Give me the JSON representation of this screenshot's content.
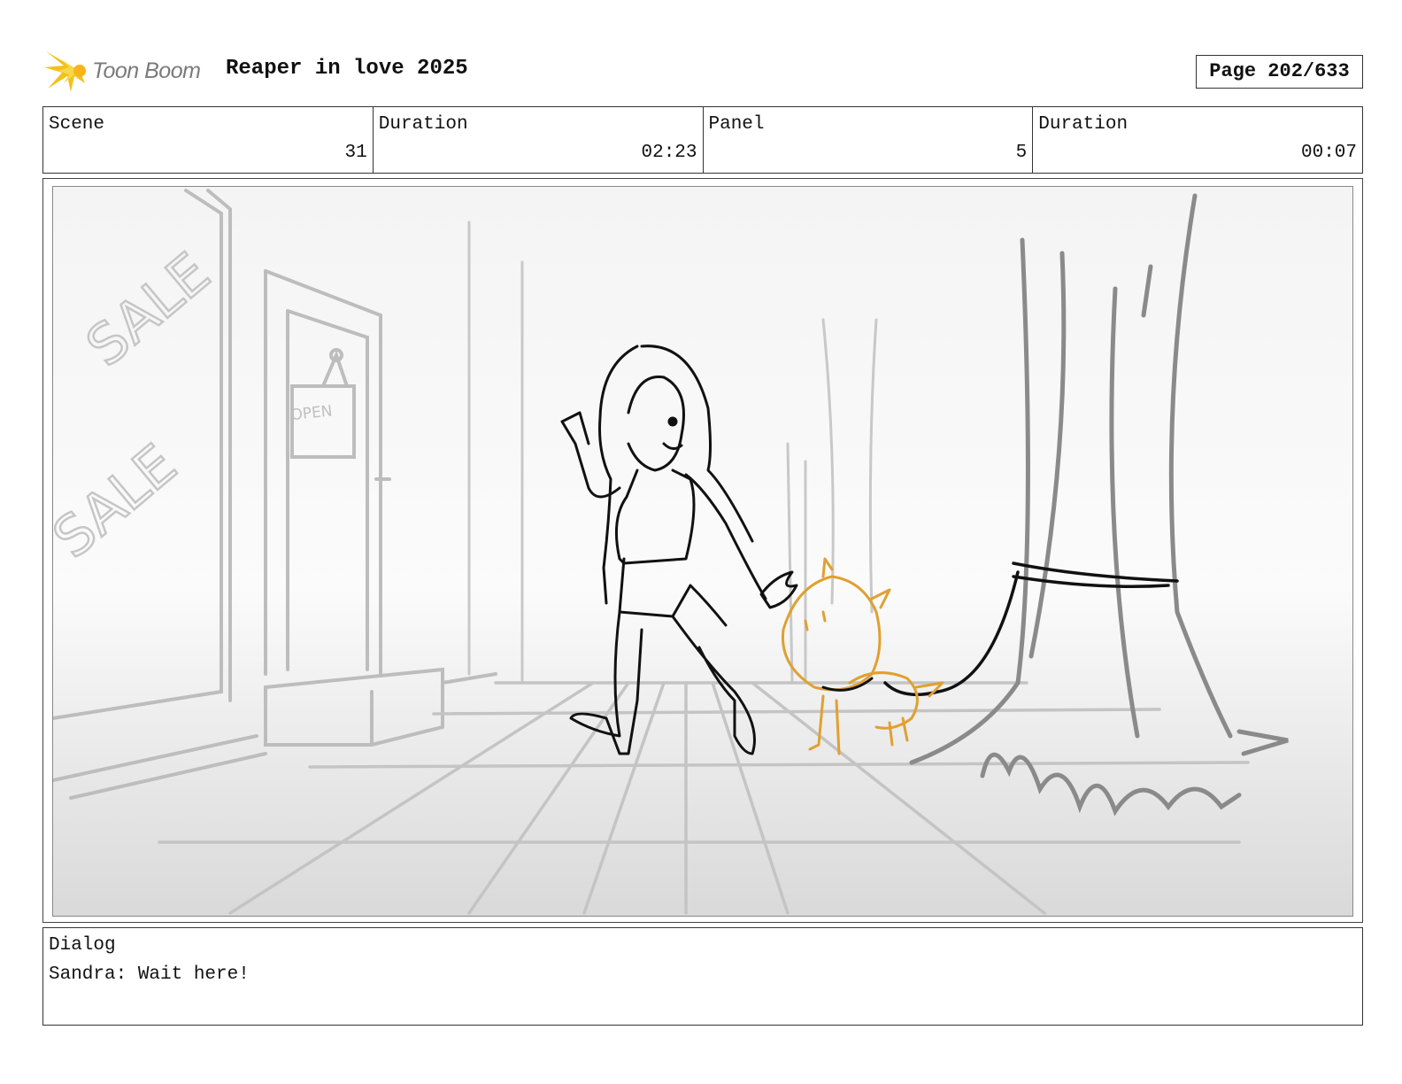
{
  "header": {
    "logo_text": "Toon Boom",
    "project_title": "Reaper in love 2025",
    "page_label": "Page 202/633"
  },
  "info": {
    "scene_label": "Scene",
    "scene_value": "31",
    "scene_duration_label": "Duration",
    "scene_duration_value": "02:23",
    "panel_label": "Panel",
    "panel_value": "5",
    "panel_duration_label": "Duration",
    "panel_duration_value": "00:07"
  },
  "panel": {
    "sign_text": "OPEN",
    "window_text_1": "SALE",
    "window_text_2": "SALE"
  },
  "dialog": {
    "label": "Dialog",
    "text": "Sandra: Wait here!"
  },
  "colors": {
    "logo_accent": "#f2c21b",
    "dog_sketch": "#e0a030",
    "background_sketch": "#bdbdbd"
  }
}
